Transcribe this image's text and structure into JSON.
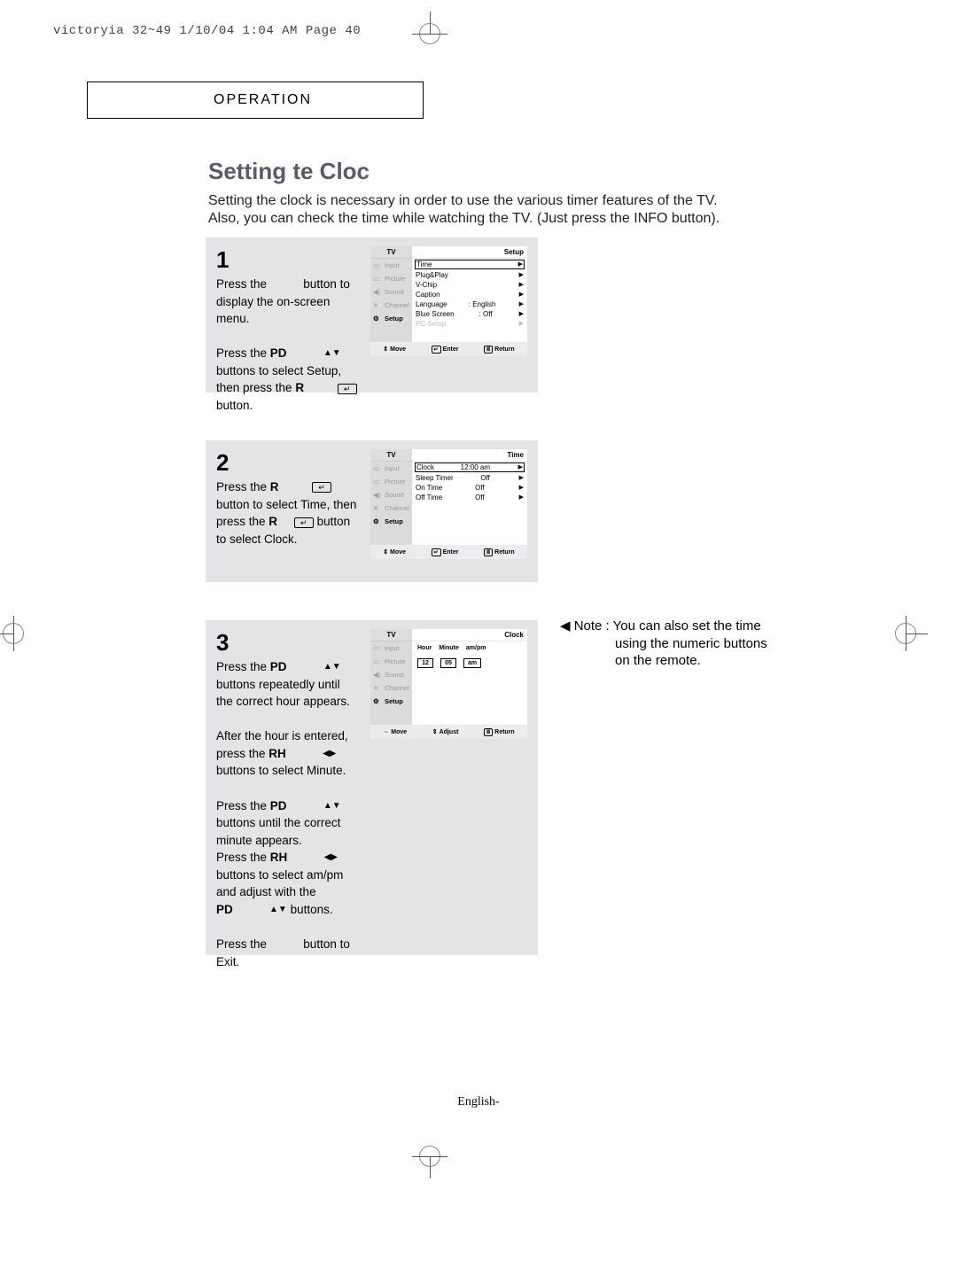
{
  "print_slug": "victoryia 32~49  1/10/04 1:04 AM  Page 40",
  "section_header": "OPERATION",
  "title": "Setting te Cloc",
  "intro": "Setting the clock is  necessary in order to use the various timer features of the TV. Also, you can check the time while watching the TV. (Just press the INFO button).",
  "step1": {
    "num": "1",
    "p1a": "Press the",
    "p1b": "button to display the on-screen menu.",
    "p2a": "Press the",
    "p2b": "PD",
    "p2c": "buttons to select Setup, then press the",
    "p2d": "R",
    "p2e": "button."
  },
  "step2": {
    "num": "2",
    "p1a": "Press the",
    "p1b": "R",
    "p1c": "button to select Time, then press the",
    "p1d": "R",
    "p1e": "button to select Clock."
  },
  "step3": {
    "num": "3",
    "p1a": "Press the",
    "p1b": "PD",
    "p1c": "buttons repeatedly until the correct hour appears.",
    "p2a": "After the hour is entered, press the",
    "p2b": "RH",
    "p2c": "buttons to select Minute.",
    "p3a": "Press the",
    "p3b": "PD",
    "p3c": "buttons until the correct minute appears.",
    "p3d": "Press the",
    "p3e": "RH",
    "p3f": "buttons to select am/pm and adjust with the",
    "p3g": "PD",
    "p3h": "buttons.",
    "p4a": "Press the",
    "p4b": "button to Exit."
  },
  "note": {
    "lead": "◀  Note :",
    "text1": "You can also set the time",
    "text2": "using the numeric buttons",
    "text3": "on the remote."
  },
  "tv": {
    "header": "TV",
    "sidebar": [
      "Input",
      "Picture",
      "Sound",
      "Channel",
      "Setup"
    ],
    "setup": {
      "title": "Setup",
      "rows": [
        {
          "lab": "Time",
          "val": ""
        },
        {
          "lab": "Plug&Play",
          "val": ""
        },
        {
          "lab": "V-Chip",
          "val": ""
        },
        {
          "lab": "Caption",
          "val": ""
        },
        {
          "lab": "Language",
          "val": ":   English"
        },
        {
          "lab": "Blue Screen",
          "val": ":   Off"
        },
        {
          "lab": "PC Setup",
          "val": ""
        }
      ]
    },
    "time": {
      "title": "Time",
      "rows": [
        {
          "lab": "Clock",
          "val": "12:00 am"
        },
        {
          "lab": "Sleep Timer",
          "val": "Off"
        },
        {
          "lab": "On Time",
          "val": "Off"
        },
        {
          "lab": "Off Time",
          "val": "Off"
        }
      ]
    },
    "clock": {
      "title": "Clock",
      "hour_lbl": "Hour",
      "min_lbl": "Minute",
      "ampm_lbl": "am/pm",
      "hour": "12",
      "min": "05",
      "ampm": "am"
    },
    "foot": {
      "move": "Move",
      "enter": "Enter",
      "return": "Return",
      "adjust": "Adjust"
    }
  },
  "footer": "English-"
}
